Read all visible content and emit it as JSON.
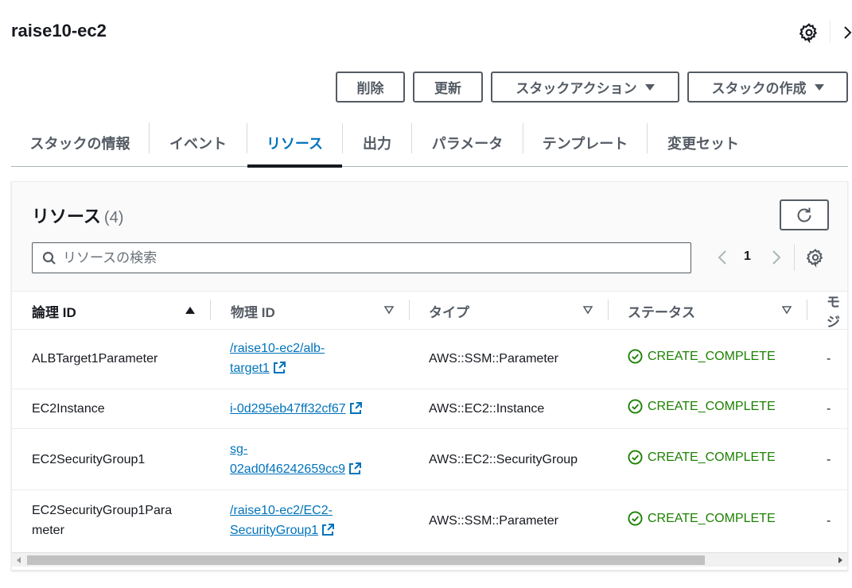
{
  "header": {
    "title": "raise10-ec2"
  },
  "actions": {
    "delete": "削除",
    "update": "更新",
    "stack_actions": "スタックアクション",
    "create_stack": "スタックの作成"
  },
  "tabs": [
    {
      "label": "スタックの情報"
    },
    {
      "label": "イベント"
    },
    {
      "label": "リソース",
      "active": true
    },
    {
      "label": "出力"
    },
    {
      "label": "パラメータ"
    },
    {
      "label": "テンプレート"
    },
    {
      "label": "変更セット"
    }
  ],
  "resources": {
    "title": "リソース",
    "count": "(4)",
    "search_placeholder": "リソースの検索",
    "page": "1",
    "columns": {
      "logical_id": "論理 ID",
      "physical_id": "物理 ID",
      "type": "タイプ",
      "status": "ステータス",
      "module": "モジ"
    },
    "rows": [
      {
        "logical_l1": "ALBTarget1Parameter",
        "logical_l2": "",
        "phys_l1": "/raise10-ec2/alb-",
        "phys_l2": "target1",
        "type": "AWS::SSM::Parameter",
        "status": "CREATE_COMPLETE",
        "module": "-"
      },
      {
        "logical_l1": "EC2Instance",
        "logical_l2": "",
        "phys_l1": "i-0d295eb47ff32cf67",
        "phys_l2": "",
        "type": "AWS::EC2::Instance",
        "status": "CREATE_COMPLETE",
        "module": "-"
      },
      {
        "logical_l1": "EC2SecurityGroup1",
        "logical_l2": "",
        "phys_l1": "sg-",
        "phys_l2": "02ad0f46242659cc9",
        "type": "AWS::EC2::SecurityGroup",
        "status": "CREATE_COMPLETE",
        "module": "-"
      },
      {
        "logical_l1": "EC2SecurityGroup1Para",
        "logical_l2": "meter",
        "phys_l1": "/raise10-ec2/EC2-",
        "phys_l2": "SecurityGroup1",
        "type": "AWS::SSM::Parameter",
        "status": "CREATE_COMPLETE",
        "module": "-"
      }
    ]
  },
  "colors": {
    "link": "#0073bb",
    "success": "#1d8102",
    "text": "#16191f",
    "muted": "#545b64"
  }
}
